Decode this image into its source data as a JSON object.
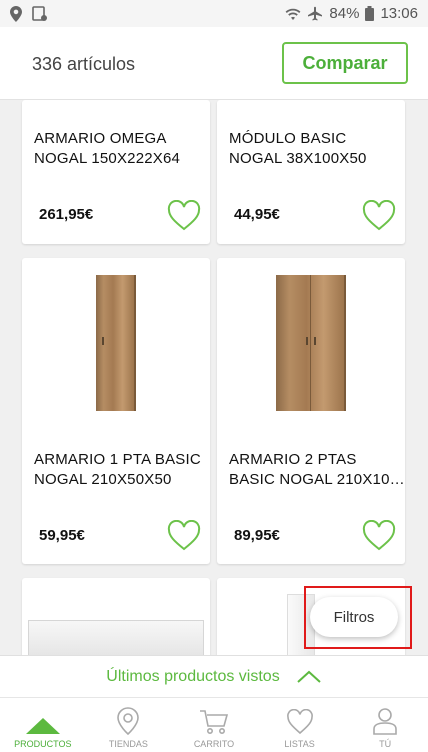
{
  "status_bar": {
    "battery": "84%",
    "time": "13:06"
  },
  "header": {
    "count": "336 artículos",
    "compare_label": "Comparar"
  },
  "products": [
    {
      "title": "ARMARIO OMEGA\nNOGAL 150X222X64",
      "price": "261,95€"
    },
    {
      "title": "MÓDULO BASIC\nNOGAL 38X100X50",
      "price": "44,95€"
    },
    {
      "title": "ARMARIO 1 PTA  BASIC\nNOGAL 210X50X50",
      "price": "59,95€"
    },
    {
      "title": "ARMARIO 2 PTAS\nBASIC NOGAL 210X10…",
      "price": "89,95€"
    }
  ],
  "filters_label": "Filtros",
  "recent_label": "Últimos productos vistos",
  "nav": [
    {
      "label": "PRODUCTOS",
      "icon": "triangle-icon"
    },
    {
      "label": "TIENDAS",
      "icon": "location-pin-icon"
    },
    {
      "label": "CARRITO",
      "icon": "cart-icon"
    },
    {
      "label": "LISTAS",
      "icon": "heart-icon"
    },
    {
      "label": "TÚ",
      "icon": "user-icon"
    }
  ],
  "colors": {
    "accent": "#5cb93f",
    "highlight_box": "#e01a1a"
  }
}
